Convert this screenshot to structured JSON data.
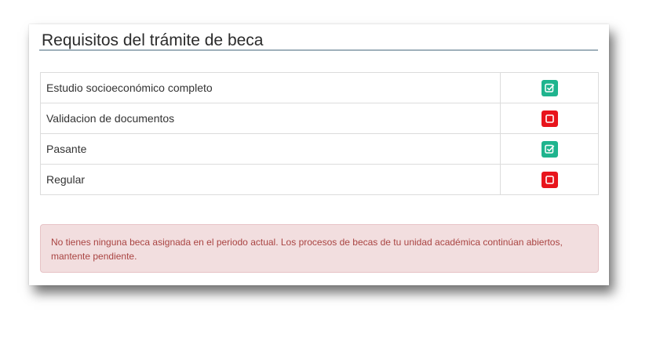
{
  "panel": {
    "title": "Requisitos del trámite de beca"
  },
  "requirements": [
    {
      "label": "Estudio socioeconómico completo",
      "status": "complete",
      "icon": "checked-box-icon",
      "color": "#1fb48e"
    },
    {
      "label": "Validacion de documentos",
      "status": "incomplete",
      "icon": "empty-box-icon",
      "color": "#e8141c"
    },
    {
      "label": "Pasante",
      "status": "complete",
      "icon": "checked-box-icon",
      "color": "#1fb48e"
    },
    {
      "label": "Regular",
      "status": "incomplete",
      "icon": "empty-box-icon",
      "color": "#e8141c"
    }
  ],
  "alert": {
    "message": "No tienes ninguna beca asignada en el periodo actual. Los procesos de becas de tu unidad académica continúan abiertos, mantente pendiente.",
    "background": "#f2dedf",
    "text_color": "#a94442"
  }
}
